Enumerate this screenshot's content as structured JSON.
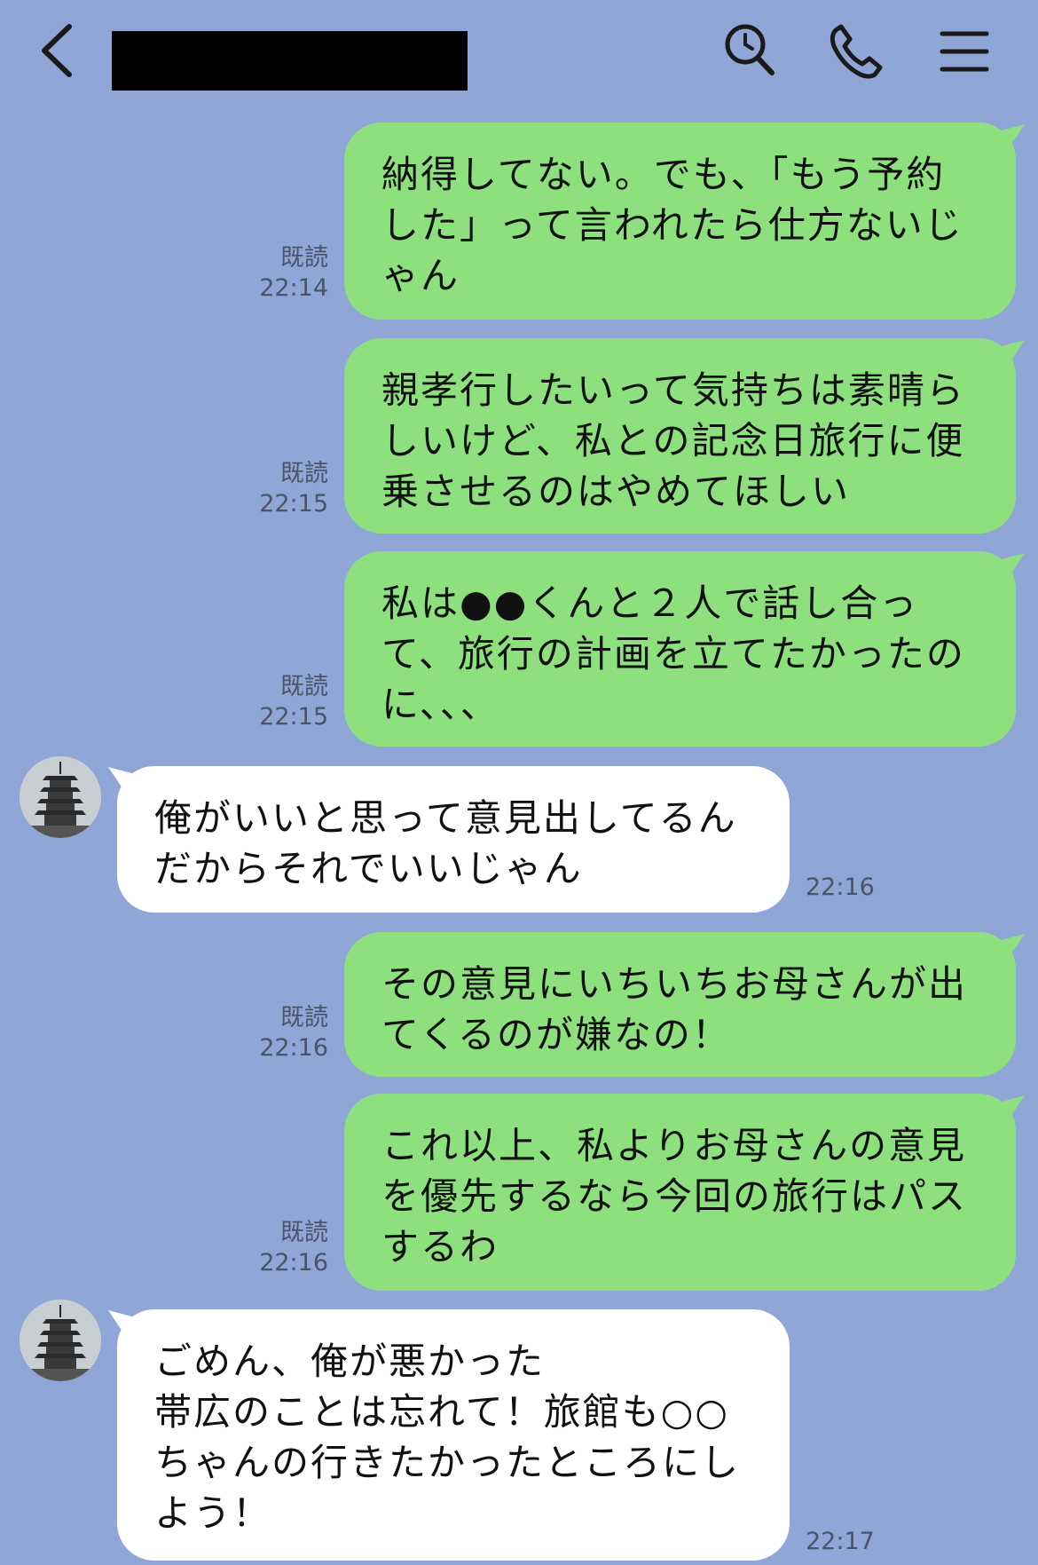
{
  "header": {
    "back_icon": "chevron-left-icon",
    "search_icon": "search-icon",
    "call_icon": "phone-icon",
    "menu_icon": "menu-icon"
  },
  "messages": [
    {
      "dir": "sent",
      "text": "納得してない。でも、「もう予約\nした」って言われたら仕方ないじ\nゃん",
      "read": "既読",
      "time": "22:14"
    },
    {
      "dir": "sent",
      "text": "親孝行したいって気持ちは素晴ら\nしいけど、私との記念日旅行に便\n乗させるのはやめてほしい",
      "read": "既読",
      "time": "22:15"
    },
    {
      "dir": "sent",
      "text": "私は●●くんと２人で話し合っ\nて、旅行の計画を立てたかったの\nに、、、",
      "read": "既読",
      "time": "22:15"
    },
    {
      "dir": "recv",
      "text": "俺がいいと思って意見出してるん\nだからそれでいいじゃん",
      "time": "22:16"
    },
    {
      "dir": "sent",
      "text": "その意見にいちいちお母さんが出\nてくるのが嫌なの！",
      "read": "既読",
      "time": "22:16"
    },
    {
      "dir": "sent",
      "text": "これ以上、私よりお母さんの意見\nを優先するなら今回の旅行はパス\nするわ",
      "read": "既読",
      "time": "22:16"
    },
    {
      "dir": "recv",
      "text": "ごめん、俺が悪かった\n帯広のことは忘れて！旅館も○○\nちゃんの行きたかったところにし\nよう！",
      "time": "22:17"
    }
  ],
  "colors": {
    "background": "#8fa6d6",
    "sent_bubble": "#8ee07f",
    "received_bubble": "#ffffff"
  }
}
